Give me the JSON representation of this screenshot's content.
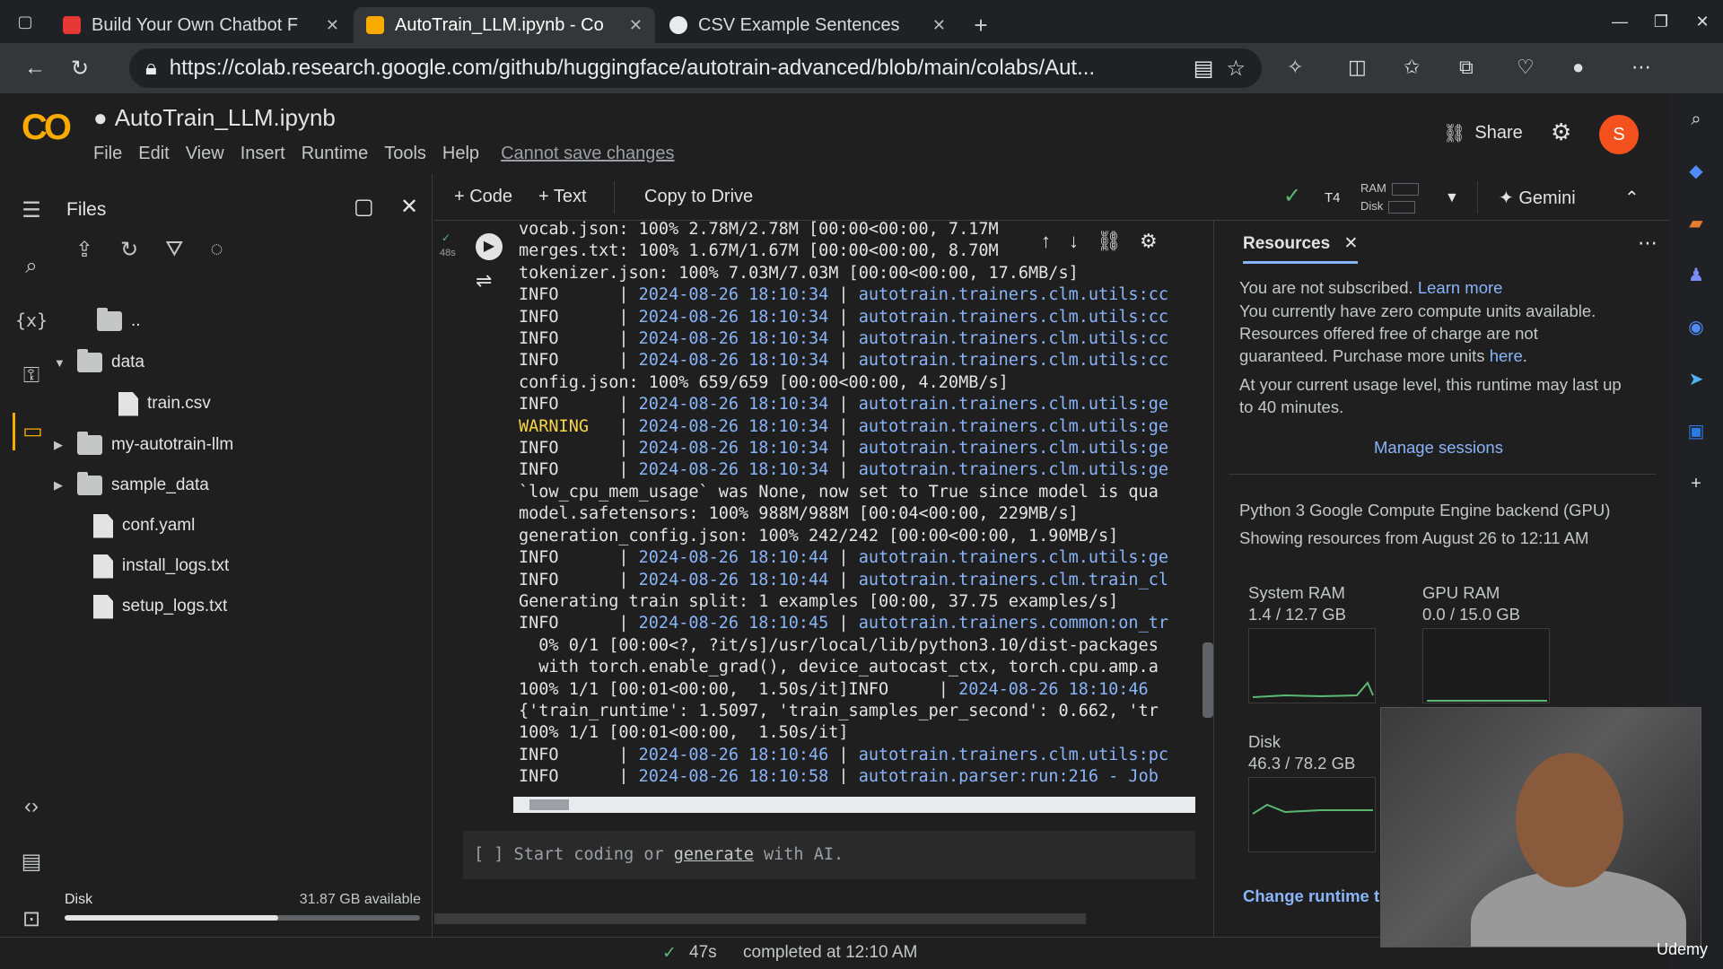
{
  "browser": {
    "tabs": [
      {
        "title": "Build Your Own Chatbot F",
        "favicon_color": "#e53935"
      },
      {
        "title": "AutoTrain_LLM.ipynb - Co",
        "favicon_color": "#f9ab00"
      },
      {
        "title": "CSV Example Sentences",
        "favicon_color": "#e8eaed"
      }
    ],
    "url": "https://colab.research.google.com/github/huggingface/autotrain-advanced/blob/main/colabs/Aut..."
  },
  "header": {
    "logo": "CO",
    "notebook_title": "AutoTrain_LLM.ipynb",
    "menu": [
      "File",
      "Edit",
      "View",
      "Insert",
      "Runtime",
      "Tools",
      "Help"
    ],
    "save_warning": "Cannot save changes",
    "share_label": "Share",
    "avatar_initial": "S"
  },
  "files": {
    "title": "Files",
    "tree": [
      {
        "name": "..",
        "type": "folder",
        "level": 0,
        "arrow": ""
      },
      {
        "name": "data",
        "type": "folder",
        "level": 0,
        "arrow": "▼"
      },
      {
        "name": "train.csv",
        "type": "file",
        "level": 1,
        "arrow": ""
      },
      {
        "name": "my-autotrain-llm",
        "type": "folder",
        "level": 0,
        "arrow": "▶"
      },
      {
        "name": "sample_data",
        "type": "folder",
        "level": 0,
        "arrow": "▶"
      },
      {
        "name": "conf.yaml",
        "type": "file",
        "level": 0,
        "arrow": ""
      },
      {
        "name": "install_logs.txt",
        "type": "file",
        "level": 0,
        "arrow": ""
      },
      {
        "name": "setup_logs.txt",
        "type": "file",
        "level": 0,
        "arrow": ""
      }
    ],
    "disk_label": "Disk",
    "disk_available": "31.87 GB available",
    "disk_used_fraction": 0.6
  },
  "toolbar": {
    "code_label": "+ Code",
    "text_label": "+ Text",
    "copy_label": "Copy to Drive",
    "gpu_label": "T4",
    "ram_label": "RAM",
    "disk_label": "Disk",
    "gemini_label": "Gemini"
  },
  "cell": {
    "exec_time": "48s",
    "output_lines": [
      {
        "kind": "plain",
        "text": "vocab.json: 100% 2.78M/2.78M [00:00<00:00, 7.17M"
      },
      {
        "kind": "plain",
        "text": "merges.txt: 100% 1.67M/1.67M [00:00<00:00, 8.70M"
      },
      {
        "kind": "plain",
        "text": "tokenizer.json: 100% 7.03M/7.03M [00:00<00:00, 17.6MB/s]"
      },
      {
        "kind": "log",
        "level": "INFO",
        "ts": "2024-08-26 18:10:34",
        "src": "autotrain.trainers.clm.utils:cc"
      },
      {
        "kind": "log",
        "level": "INFO",
        "ts": "2024-08-26 18:10:34",
        "src": "autotrain.trainers.clm.utils:cc"
      },
      {
        "kind": "log",
        "level": "INFO",
        "ts": "2024-08-26 18:10:34",
        "src": "autotrain.trainers.clm.utils:cc"
      },
      {
        "kind": "log",
        "level": "INFO",
        "ts": "2024-08-26 18:10:34",
        "src": "autotrain.trainers.clm.utils:cc"
      },
      {
        "kind": "plain",
        "text": "config.json: 100% 659/659 [00:00<00:00, 4.20MB/s]"
      },
      {
        "kind": "log",
        "level": "INFO",
        "ts": "2024-08-26 18:10:34",
        "src": "autotrain.trainers.clm.utils:ge"
      },
      {
        "kind": "log",
        "level": "WARNING",
        "ts": "2024-08-26 18:10:34",
        "src": "autotrain.trainers.clm.utils:ge"
      },
      {
        "kind": "log",
        "level": "INFO",
        "ts": "2024-08-26 18:10:34",
        "src": "autotrain.trainers.clm.utils:ge"
      },
      {
        "kind": "log",
        "level": "INFO",
        "ts": "2024-08-26 18:10:34",
        "src": "autotrain.trainers.clm.utils:ge"
      },
      {
        "kind": "plain",
        "text": "`low_cpu_mem_usage` was None, now set to True since model is qua"
      },
      {
        "kind": "plain",
        "text": "model.safetensors: 100% 988M/988M [00:04<00:00, 229MB/s]"
      },
      {
        "kind": "plain",
        "text": "generation_config.json: 100% 242/242 [00:00<00:00, 1.90MB/s]"
      },
      {
        "kind": "log",
        "level": "INFO",
        "ts": "2024-08-26 18:10:44",
        "src": "autotrain.trainers.clm.utils:ge"
      },
      {
        "kind": "log",
        "level": "INFO",
        "ts": "2024-08-26 18:10:44",
        "src": "autotrain.trainers.clm.train_cl"
      },
      {
        "kind": "plain",
        "text": "Generating train split: 1 examples [00:00, 37.75 examples/s]"
      },
      {
        "kind": "log",
        "level": "INFO",
        "ts": "2024-08-26 18:10:45",
        "src": "autotrain.trainers.common:on_tr"
      },
      {
        "kind": "plain",
        "text": "  0% 0/1 [00:00<?, ?it/s]/usr/local/lib/python3.10/dist-packages"
      },
      {
        "kind": "plain",
        "text": "  with torch.enable_grad(), device_autocast_ctx, torch.cpu.amp.a"
      },
      {
        "kind": "mixed",
        "text": "100% 1/1 [00:01<00:00,  1.50s/it]INFO     | ",
        "ts": "2024-08-26 18:10:46"
      },
      {
        "kind": "plain",
        "text": "{'train_runtime': 1.5097, 'train_samples_per_second': 0.662, 'tr"
      },
      {
        "kind": "plain",
        "text": "100% 1/1 [00:01<00:00,  1.50s/it]"
      },
      {
        "kind": "log",
        "level": "INFO",
        "ts": "2024-08-26 18:10:46",
        "src": "autotrain.trainers.clm.utils:pc"
      },
      {
        "kind": "log",
        "level": "INFO",
        "ts": "2024-08-26 18:10:58",
        "src": "autotrain.parser:run:216 - Job"
      }
    ],
    "empty_cell_prefix": "[ ]  Start coding or ",
    "empty_cell_link": "generate",
    "empty_cell_suffix": " with AI."
  },
  "resources": {
    "tab_label": "Resources",
    "not_subscribed": "You are not subscribed.",
    "learn_more": "Learn more",
    "zero_units_1": "You currently have zero compute units available.",
    "zero_units_2": "Resources offered free of charge are not",
    "zero_units_3": "guaranteed. Purchase more units",
    "here": "here",
    "usage_1": "At your current usage level, this runtime may last up",
    "usage_2": "to 40 minutes.",
    "manage_sessions": "Manage sessions",
    "backend": "Python 3 Google Compute Engine backend (GPU)",
    "showing_range": "Showing resources from August 26 to 12:11 AM",
    "system_ram_label": "System RAM",
    "system_ram_value": "1.4 / 12.7 GB",
    "gpu_ram_label": "GPU RAM",
    "gpu_ram_value": "0.0 / 15.0 GB",
    "disk_label": "Disk",
    "disk_value": "46.3 / 78.2 GB",
    "change_runtime": "Change runtime t"
  },
  "status": {
    "time": "47s",
    "completed": "completed at 12:10 AM"
  },
  "watermark": "Udemy"
}
